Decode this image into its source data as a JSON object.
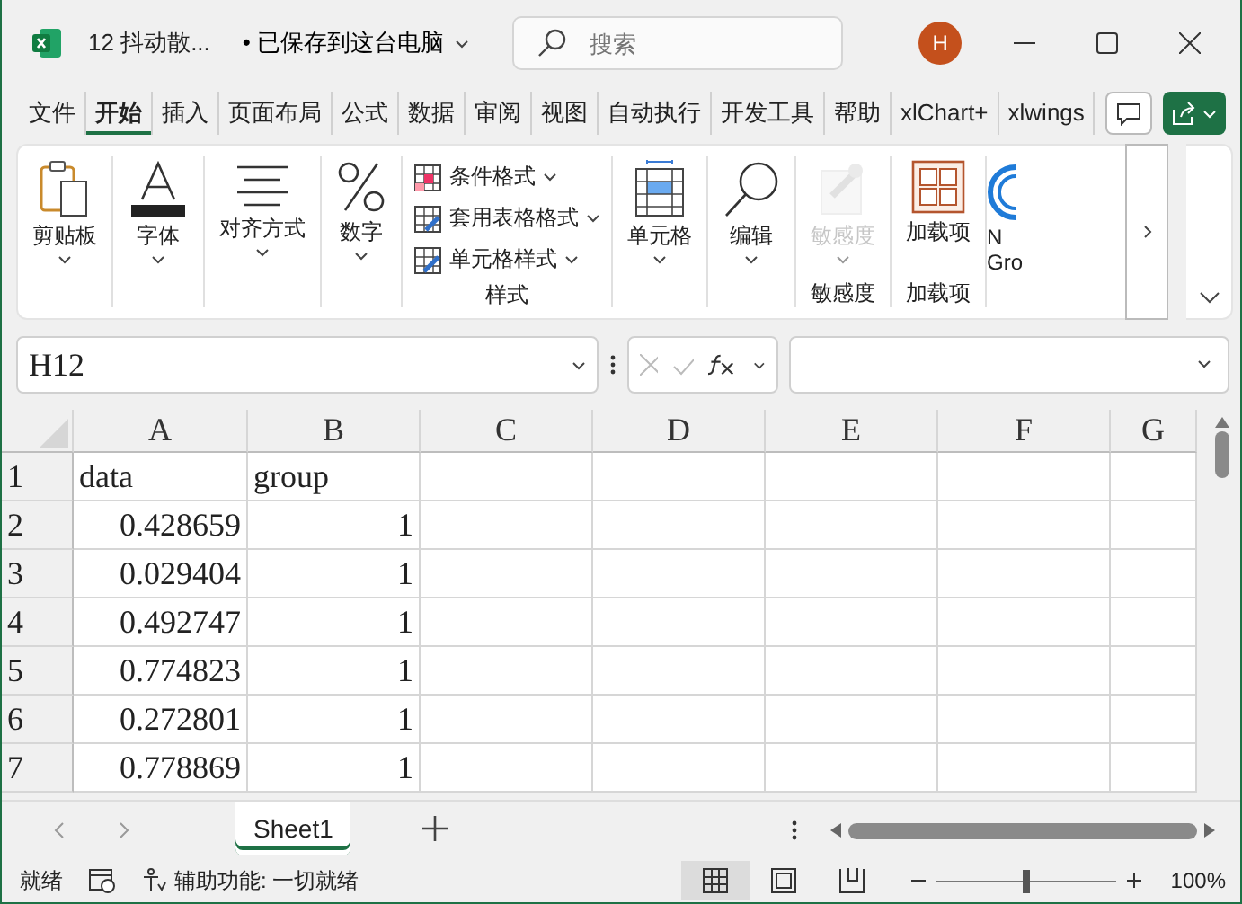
{
  "window": {
    "title": "12 抖动散...",
    "save_status": "• 已保存到这台电脑",
    "search_placeholder": "搜索",
    "avatar": "H"
  },
  "ribbon_tabs": [
    {
      "label": "文件",
      "selected": false
    },
    {
      "label": "开始",
      "selected": true
    },
    {
      "label": "插入",
      "selected": false
    },
    {
      "label": "页面布局",
      "selected": false
    },
    {
      "label": "公式",
      "selected": false
    },
    {
      "label": "数据",
      "selected": false
    },
    {
      "label": "审阅",
      "selected": false
    },
    {
      "label": "视图",
      "selected": false
    },
    {
      "label": "自动执行",
      "selected": false
    },
    {
      "label": "开发工具",
      "selected": false
    },
    {
      "label": "帮助",
      "selected": false
    },
    {
      "label": "xlChart+",
      "selected": false
    },
    {
      "label": "xlwings",
      "selected": false
    }
  ],
  "ribbon": [
    {
      "kind": "clipboard",
      "label": "剪贴板",
      "disabled": false
    },
    {
      "kind": "font",
      "label": "字体",
      "disabled": false
    },
    {
      "kind": "align",
      "label": "对齐方式",
      "disabled": false
    },
    {
      "kind": "number",
      "label": "数字",
      "disabled": false
    },
    {
      "kind": "styles",
      "group_label": "样式",
      "items": [
        {
          "kind": "conditional",
          "label": "条件格式"
        },
        {
          "kind": "table",
          "label": "套用表格格式"
        },
        {
          "kind": "cellstyle",
          "label": "单元格样式"
        }
      ]
    },
    {
      "kind": "cells",
      "label": "单元格",
      "disabled": false
    },
    {
      "kind": "editing",
      "label": "编辑",
      "disabled": false
    },
    {
      "kind": "sensitivity",
      "label": "敏感度",
      "disabled": true,
      "group_label": "敏感度"
    },
    {
      "kind": "addins",
      "label": "加载项",
      "disabled": false,
      "group_label": "加载项"
    },
    {
      "kind": "partial",
      "label": "N Gro",
      "disabled": false
    }
  ],
  "formula_bar": {
    "name_box": "H12"
  },
  "sheet": {
    "columns": [
      "A",
      "B",
      "C",
      "D",
      "E",
      "F",
      "G"
    ],
    "rows": [
      {
        "number": "1",
        "cells": [
          "data",
          "group"
        ]
      },
      {
        "number": "2",
        "cells": [
          "0.428659",
          "1"
        ]
      },
      {
        "number": "3",
        "cells": [
          "0.029404",
          "1"
        ]
      },
      {
        "number": "4",
        "cells": [
          "0.492747",
          "1"
        ]
      },
      {
        "number": "5",
        "cells": [
          "0.774823",
          "1"
        ]
      },
      {
        "number": "6",
        "cells": [
          "0.272801",
          "1"
        ]
      },
      {
        "number": "7",
        "cells": [
          "0.778869",
          "1"
        ]
      }
    ]
  },
  "sheet_tabs": [
    {
      "label": "Sheet1",
      "selected": true
    }
  ],
  "status_bar": {
    "status": "就绪",
    "accessibility": "辅助功能: 一切就绪",
    "views": [
      {
        "kind": "normal",
        "selected": true
      },
      {
        "kind": "page",
        "selected": false
      },
      {
        "kind": "break",
        "selected": false
      }
    ],
    "zoom": {
      "level": 0.5,
      "reading": "100%"
    }
  }
}
